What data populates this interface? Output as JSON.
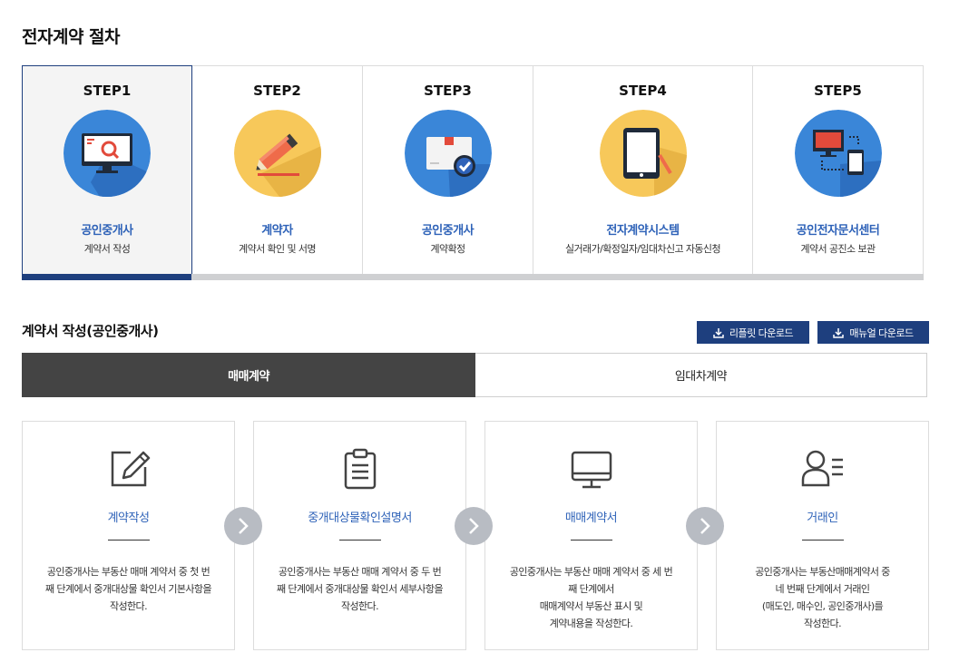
{
  "page_title": "전자계약 절차",
  "steps": [
    {
      "label": "STEP1",
      "actor": "공인중개사",
      "task": "계약서 작성",
      "icon": "monitor-search-icon"
    },
    {
      "label": "STEP2",
      "actor": "계약자",
      "task": "계약서 확인 및 서명",
      "icon": "pencil-sign-icon"
    },
    {
      "label": "STEP3",
      "actor": "공인중개사",
      "task": "계약확정",
      "icon": "box-check-icon"
    },
    {
      "label": "STEP4",
      "actor": "전자계약시스템",
      "task": "실거래가/확정일자/임대차신고 자동신청",
      "icon": "tablet-icon"
    },
    {
      "label": "STEP5",
      "actor": "공인전자문서센터",
      "task": "계약서 공진소 보관",
      "icon": "devices-network-icon"
    }
  ],
  "section": {
    "title": "계약서 작성(공인중개사)",
    "leaflet_button": "리플릿 다운로드",
    "manual_button": "매뉴얼 다운로드"
  },
  "tabs": [
    {
      "label": "매매계약",
      "active": true
    },
    {
      "label": "임대차계약",
      "active": false
    }
  ],
  "cards": [
    {
      "title": "계약작성",
      "icon": "edit-icon",
      "desc": "공인중개사는 부동산 매매 계약서 중 첫 번\n째 단계에서 중개대상물 확인서 기본사항을\n작성한다."
    },
    {
      "title": "중개대상물확인설명서",
      "icon": "clipboard-icon",
      "desc": "공인중개사는 부동산 매매 계약서 중 두 번\n째 단계에서 중개대상물 확인서 세부사항을\n작성한다."
    },
    {
      "title": "매매계약서",
      "icon": "monitor-icon",
      "desc": "공인중개사는 부동산 매매 계약서 중 세 번\n째 단계에서\n매매계약서 부동산 표시 및\n계약내용을 작성한다."
    },
    {
      "title": "거래인",
      "icon": "person-list-icon",
      "desc": "공인중개사는 부동산매매계약서 중\n네 번째 단계에서 거래인\n(매도인, 매수인, 공인중개사)를\n작성한다."
    }
  ],
  "colors": {
    "navy": "#1e3f7e",
    "link_blue": "#2e62b8",
    "tab_active": "#444444",
    "circle_blue": "#3a86d8",
    "circle_yellow": "#f7c85a",
    "arrow_gray": "#b8bcc3"
  }
}
